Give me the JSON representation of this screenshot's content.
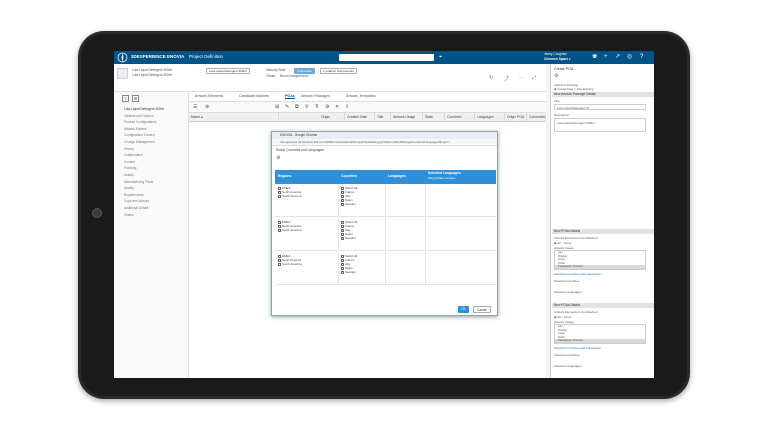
{
  "topbar": {
    "brand": "3DEXPERIENCE ENOVIA",
    "app": "Project Definition",
    "user_name": "Jenny Coughlan",
    "user_space": "Common Space ▾",
    "accent": "#005386"
  },
  "header": {
    "title": "Lota Liquid Detergent 300ml",
    "subtitle": "Lota Liquid Detergent 300ml",
    "maturity_label": "Maturity State",
    "maturity_value": "Preliminary",
    "owner_label": "Owner",
    "owner_value": "Bruno Marquerneau",
    "chip": "Lota Liquid Detergent 300ml",
    "chip2": "1 Graphic Components"
  },
  "sidebar": {
    "items": [
      "Lota Liquid Detergent 300ml",
      "Variants and Options",
      "Product Configurations",
      "Artwork Folders",
      "Configuration Context",
      "Change Management",
      "History",
      "Collaboration",
      "Content",
      "Planning",
      "Assets",
      "Manufacturing Plans",
      "Quality",
      "Requirements",
      "Copy and Artwork",
      "Additional Details",
      "Claims"
    ]
  },
  "tabs": [
    "Artwork Elements",
    "Candidate Markets",
    "POAs",
    "Artwork Packages",
    "Artwork Templates"
  ],
  "grid": {
    "columns": [
      "Name ▴",
      "Origin",
      "Created Date",
      "Title",
      "Artwork Usage",
      "State",
      "Countries",
      "Languages",
      "Origin POA",
      "Connected Arts"
    ]
  },
  "dialog": {
    "title": "ENOVIA - Google Chrome",
    "url": "rdevopsrp1vi.uk.bestinet.3ds.com:9000/enovia/web/AWLCopyPasteDialog.jsp?table=AWL/ManageCountriesLanguageTab.jsp?...",
    "instruction": "Select Countries and Languages",
    "headers": [
      "Regions",
      "Countries",
      "Languages",
      "Selected Languages",
      "Drag & Attach countries"
    ],
    "rows": [
      {
        "regions": [
          "EMEA",
          "North America",
          "South America"
        ],
        "countries": [
          "Select All",
          "France",
          "Italy",
          "Spain",
          "Sweden"
        ]
      },
      {
        "regions": [
          "EMEA",
          "North America",
          "South America"
        ],
        "countries": [
          "Select All",
          "France",
          "Italy",
          "Spain",
          "Sweden"
        ]
      },
      {
        "regions": [
          "EMEA",
          "North America",
          "South America"
        ],
        "countries": [
          "Select All",
          "France",
          "Italy",
          "Spain",
          "Sweden"
        ]
      }
    ],
    "ok": "OK",
    "cancel": "Cancel"
  },
  "right_panel": {
    "title": "Create POA",
    "attach_label": "Attach to Package",
    "opt1": "Create New",
    "opt2": "Use Existing",
    "section1": "New Artwork Package Details",
    "title_label": "Title",
    "title_value": "Lota Liquid Detergent 3l",
    "desc_label": "Description",
    "desc_value": "Lota Liquid Detergent 300ml",
    "section2": "New POAs Details",
    "attach_elements": "Artwork Elements to be Attached",
    "all": "All",
    "none": "None",
    "usage_label": "Artwork Usage",
    "usage_options": [
      "Lay",
      "Display",
      "Insert",
      "Other",
      "Packaging / Primary"
    ],
    "selected_cl": "Selected Countries and Languages",
    "selected_c": "Selected Countries",
    "selected_l": "Selected Languages",
    "section3": "New POAs Details"
  }
}
